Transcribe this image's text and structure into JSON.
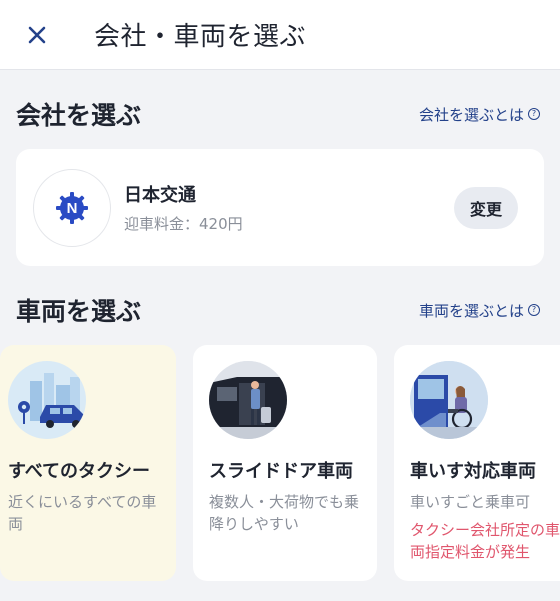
{
  "header": {
    "title": "会社・車両を選ぶ",
    "close_icon": "close-icon"
  },
  "company_section": {
    "title": "会社を選ぶ",
    "info_link": "会社を選ぶとは",
    "company": {
      "name": "日本交通",
      "fee": "迎車料金：420円",
      "logo_letter": "N",
      "logo_color": "#2a4bc4"
    },
    "change_label": "変更"
  },
  "vehicle_section": {
    "title": "車両を選ぶ",
    "info_link": "車両を選ぶとは",
    "vehicles": [
      {
        "name": "すべてのタクシー",
        "desc_1": "近くにいるすべての車",
        "desc_2": "両",
        "selected": true
      },
      {
        "name": "スライドドア車両",
        "desc_1": "複数人・大荷物でも乗",
        "desc_2": "降りしやすい",
        "selected": false
      },
      {
        "name": "車いす対応車両",
        "desc_1": "車いすごと乗車可",
        "warn_1": "タクシー会社所定の車",
        "warn_2": "両指定料金が発生",
        "selected": false
      }
    ]
  },
  "colors": {
    "accent": "#23418a",
    "warning": "#e0566d",
    "selected_bg": "#fbf8e6"
  }
}
